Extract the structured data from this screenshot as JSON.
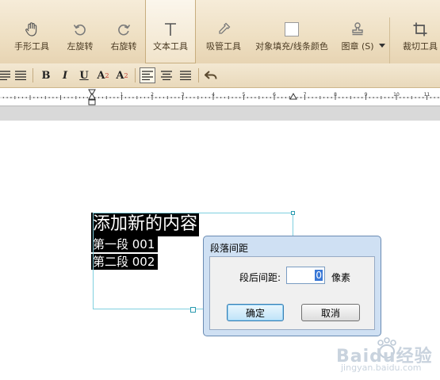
{
  "toolbar": {
    "tools": [
      {
        "label": "手形工具",
        "icon": "hand-icon"
      },
      {
        "label": "左旋转",
        "icon": "rotate-left-icon"
      },
      {
        "label": "右旋转",
        "icon": "rotate-right-icon"
      },
      {
        "label": "文本工具",
        "icon": "text-tool-icon",
        "active": true
      },
      {
        "label": "吸管工具",
        "icon": "eyedropper-icon"
      },
      {
        "label": "对象填充/线条颜色",
        "icon": "fill-color-icon"
      },
      {
        "label": "图章 (S)",
        "icon": "stamp-icon"
      },
      {
        "label": "裁切工具",
        "icon": "crop-icon"
      }
    ]
  },
  "formatbar": {
    "bold": "B",
    "italic": "I",
    "underline": "U",
    "superscript": "A",
    "superscript_mark": "2",
    "subscript": "A",
    "subscript_mark": "2"
  },
  "ruler": {
    "numbers": [
      "1",
      "2",
      "3",
      "4",
      "5",
      "6",
      "7",
      "8",
      "9",
      "10",
      "11",
      "12"
    ]
  },
  "canvas": {
    "line1": "添加新的内容",
    "line2": "第一段 001",
    "line3": "第二段 002"
  },
  "dialog": {
    "title": "段落间距",
    "field_label": "段后间距:",
    "field_value": "0",
    "unit": "像素",
    "ok": "确定",
    "cancel": "取消"
  },
  "watermark": {
    "text": "Baidu经验",
    "url": "jingyan.baidu.com"
  }
}
